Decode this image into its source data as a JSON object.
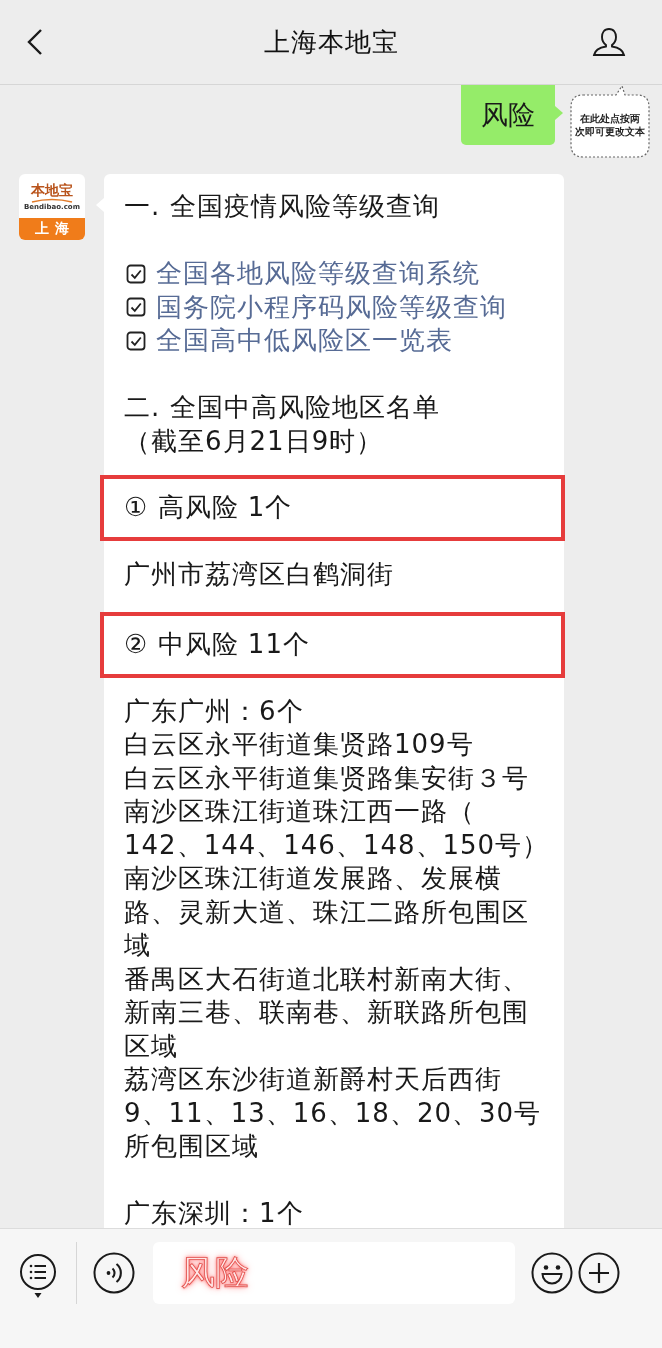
{
  "header": {
    "title": "上海本地宝"
  },
  "messages": [
    {
      "kind": "sent",
      "text": "风险",
      "sticker": {
        "lines": [
          "在此处点按两",
          "次即可更改文本"
        ]
      }
    },
    {
      "kind": "received",
      "avatar": {
        "brand": "本地宝",
        "domain": "Bendibao.com",
        "city": "上海"
      },
      "sections": [
        {
          "items": [
            {
              "kind": "text",
              "text": "一. 全国疫情风险等级查询"
            }
          ]
        },
        {
          "items": [
            {
              "kind": "link",
              "text": "全国各地风险等级查询系统"
            },
            {
              "kind": "link",
              "text": "国务院小程序码风险等级查询"
            },
            {
              "kind": "link",
              "text": "全国高中低风险区一览表"
            }
          ]
        },
        {
          "items": [
            {
              "kind": "text",
              "text": "二. 全国中高风险地区名单"
            },
            {
              "kind": "text",
              "text": "（截至6月21日9时）"
            },
            {
              "kind": "framed",
              "text": "① 高风险 1个"
            },
            {
              "kind": "text",
              "text": "广州市荔湾区白鹤洞街"
            },
            {
              "kind": "framed",
              "text": "② 中风险 11个"
            },
            {
              "kind": "text",
              "text": "广东广州：6个"
            },
            {
              "kind": "text",
              "text": "白云区永平街道集贤路109号"
            },
            {
              "kind": "text",
              "text": "白云区永平街道集贤路集安街３号"
            },
            {
              "kind": "text",
              "lines": [
                "南沙区珠江街道珠江西一路（",
                "142、144、146、148、150号）"
              ]
            },
            {
              "kind": "text",
              "lines": [
                "南沙区珠江街道发展路、发展横",
                "路、灵新大道、珠江二路所包围区",
                "域"
              ]
            },
            {
              "kind": "text",
              "lines": [
                "番禺区大石街道北联村新南大街、",
                "新南三巷、联南巷、新联路所包围",
                "区域"
              ]
            },
            {
              "kind": "text",
              "lines": [
                "荔湾区东沙街道新爵村天后西街",
                "9、11、13、16、18、20、30号",
                "所包围区域"
              ]
            }
          ]
        },
        {
          "items": [
            {
              "kind": "text",
              "text": "广东深圳：1个"
            }
          ]
        }
      ]
    }
  ],
  "composer": {
    "input": {
      "value": "风险"
    }
  }
}
